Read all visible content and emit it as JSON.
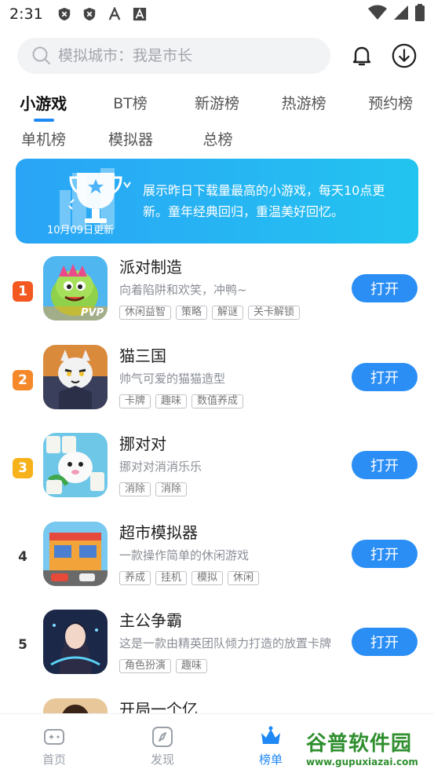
{
  "status_bar": {
    "time": "2:31"
  },
  "search": {
    "placeholder": "模拟城市：我是市长"
  },
  "tabs_row1": [
    "小游戏",
    "BT榜",
    "新游榜",
    "热游榜",
    "预约榜"
  ],
  "tabs_row2": [
    "单机榜",
    "模拟器",
    "总榜"
  ],
  "banner": {
    "date": "10月09日更新",
    "text": "展示昨日下载量最高的小游戏，每天10点更新。童年经典回归，重温美好回忆。"
  },
  "games": [
    {
      "rank": "1",
      "name": "派对制造",
      "desc": "向着陷阱和欢笑，冲鸭~",
      "tags": [
        "休闲益智",
        "策略",
        "解谜",
        "关卡解锁"
      ],
      "button": "打开",
      "badge_color": "#f2581f",
      "icon_label": "PVP"
    },
    {
      "rank": "2",
      "name": "猫三国",
      "desc": "帅气可爱的猫猫造型",
      "tags": [
        "卡牌",
        "趣味",
        "数值养成"
      ],
      "button": "打开",
      "badge_color": "#f5892a"
    },
    {
      "rank": "3",
      "name": "挪对对",
      "desc": "挪对对消消乐乐",
      "tags": [
        "消除",
        "消除"
      ],
      "button": "打开",
      "badge_color": "#f7b21b"
    },
    {
      "rank": "4",
      "name": "超市模拟器",
      "desc": "一款操作简单的休闲游戏",
      "tags": [
        "养成",
        "挂机",
        "模拟",
        "休闲"
      ],
      "button": "打开"
    },
    {
      "rank": "5",
      "name": "主公争霸",
      "desc": "这是一款由精英团队倾力打造的放置卡牌",
      "tags": [
        "角色扮演",
        "趣味"
      ],
      "button": "打开"
    },
    {
      "rank": "",
      "name": "开局一个亿",
      "desc": "",
      "tags": [],
      "button": ""
    }
  ],
  "bottom_nav": [
    "首页",
    "发现",
    "榜单"
  ],
  "watermark": {
    "title": "谷普软件园",
    "url": "www.gupuxiazai.com"
  },
  "colors": {
    "accent": "#1e88f5",
    "button": "#2b8ef5"
  }
}
